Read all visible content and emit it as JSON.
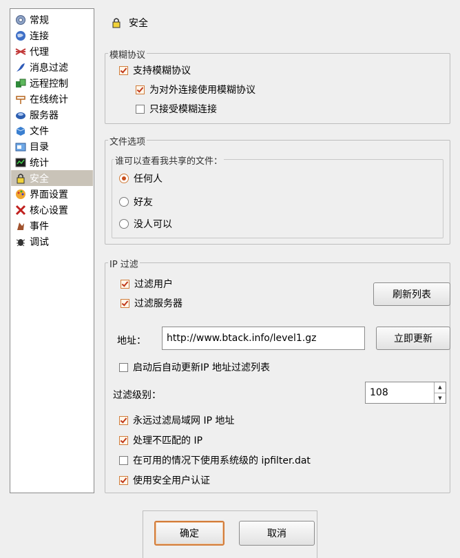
{
  "sidebar": {
    "items": [
      {
        "label": "常规",
        "icon": "gear-icon"
      },
      {
        "label": "连接",
        "icon": "globe-icon"
      },
      {
        "label": "代理",
        "icon": "proxy-icon"
      },
      {
        "label": "消息过滤",
        "icon": "filter-icon"
      },
      {
        "label": "远程控制",
        "icon": "remote-icon"
      },
      {
        "label": "在线统计",
        "icon": "signpost-icon"
      },
      {
        "label": "服务器",
        "icon": "server-icon"
      },
      {
        "label": "文件",
        "icon": "file-icon"
      },
      {
        "label": "目录",
        "icon": "folder-icon"
      },
      {
        "label": "统计",
        "icon": "chart-icon"
      },
      {
        "label": "安全",
        "icon": "lock-icon"
      },
      {
        "label": "界面设置",
        "icon": "palette-icon"
      },
      {
        "label": "核心设置",
        "icon": "core-icon"
      },
      {
        "label": "事件",
        "icon": "events-icon"
      },
      {
        "label": "调试",
        "icon": "bug-icon"
      }
    ],
    "selected_index": 10
  },
  "header": {
    "title": "安全"
  },
  "obfuscation": {
    "title": "模糊协议",
    "support_label": "支持模糊协议",
    "support_checked": true,
    "outgoing_label": "为对外连接使用模糊协议",
    "outgoing_checked": true,
    "only_label": "只接受模糊连接",
    "only_checked": false
  },
  "file_options": {
    "title": "文件选项",
    "who_title": "谁可以查看我共享的文件：",
    "options": [
      "任何人",
      "好友",
      "没人可以"
    ],
    "selected": 0
  },
  "ip_filter": {
    "title": "IP 过滤",
    "filter_clients_label": "过滤用户",
    "filter_clients_checked": true,
    "filter_servers_label": "过滤服务器",
    "filter_servers_checked": true,
    "reload_button": "刷新列表",
    "address_label": "地址：",
    "address_value": "http://www.btack.info/level1.gz",
    "update_button": "立即更新",
    "auto_update_label": "启动后自动更新IP 地址过滤列表",
    "auto_update_checked": false,
    "level_label": "过滤级别：",
    "level_value": "108",
    "lan_label": "永远过滤局域网 IP 地址",
    "lan_checked": true,
    "paranoid_label": "处理不匹配的 IP",
    "paranoid_checked": true,
    "system_label": "在可用的情况下使用系统级的 ipfilter.dat",
    "system_checked": false,
    "secure_ident_label": "使用安全用户认证",
    "secure_ident_checked": true
  },
  "buttons": {
    "ok": "确定",
    "cancel": "取消"
  },
  "colors": {
    "accent": "#d37d3b",
    "check": "#c0391b",
    "selection": "#c9c3b8"
  }
}
